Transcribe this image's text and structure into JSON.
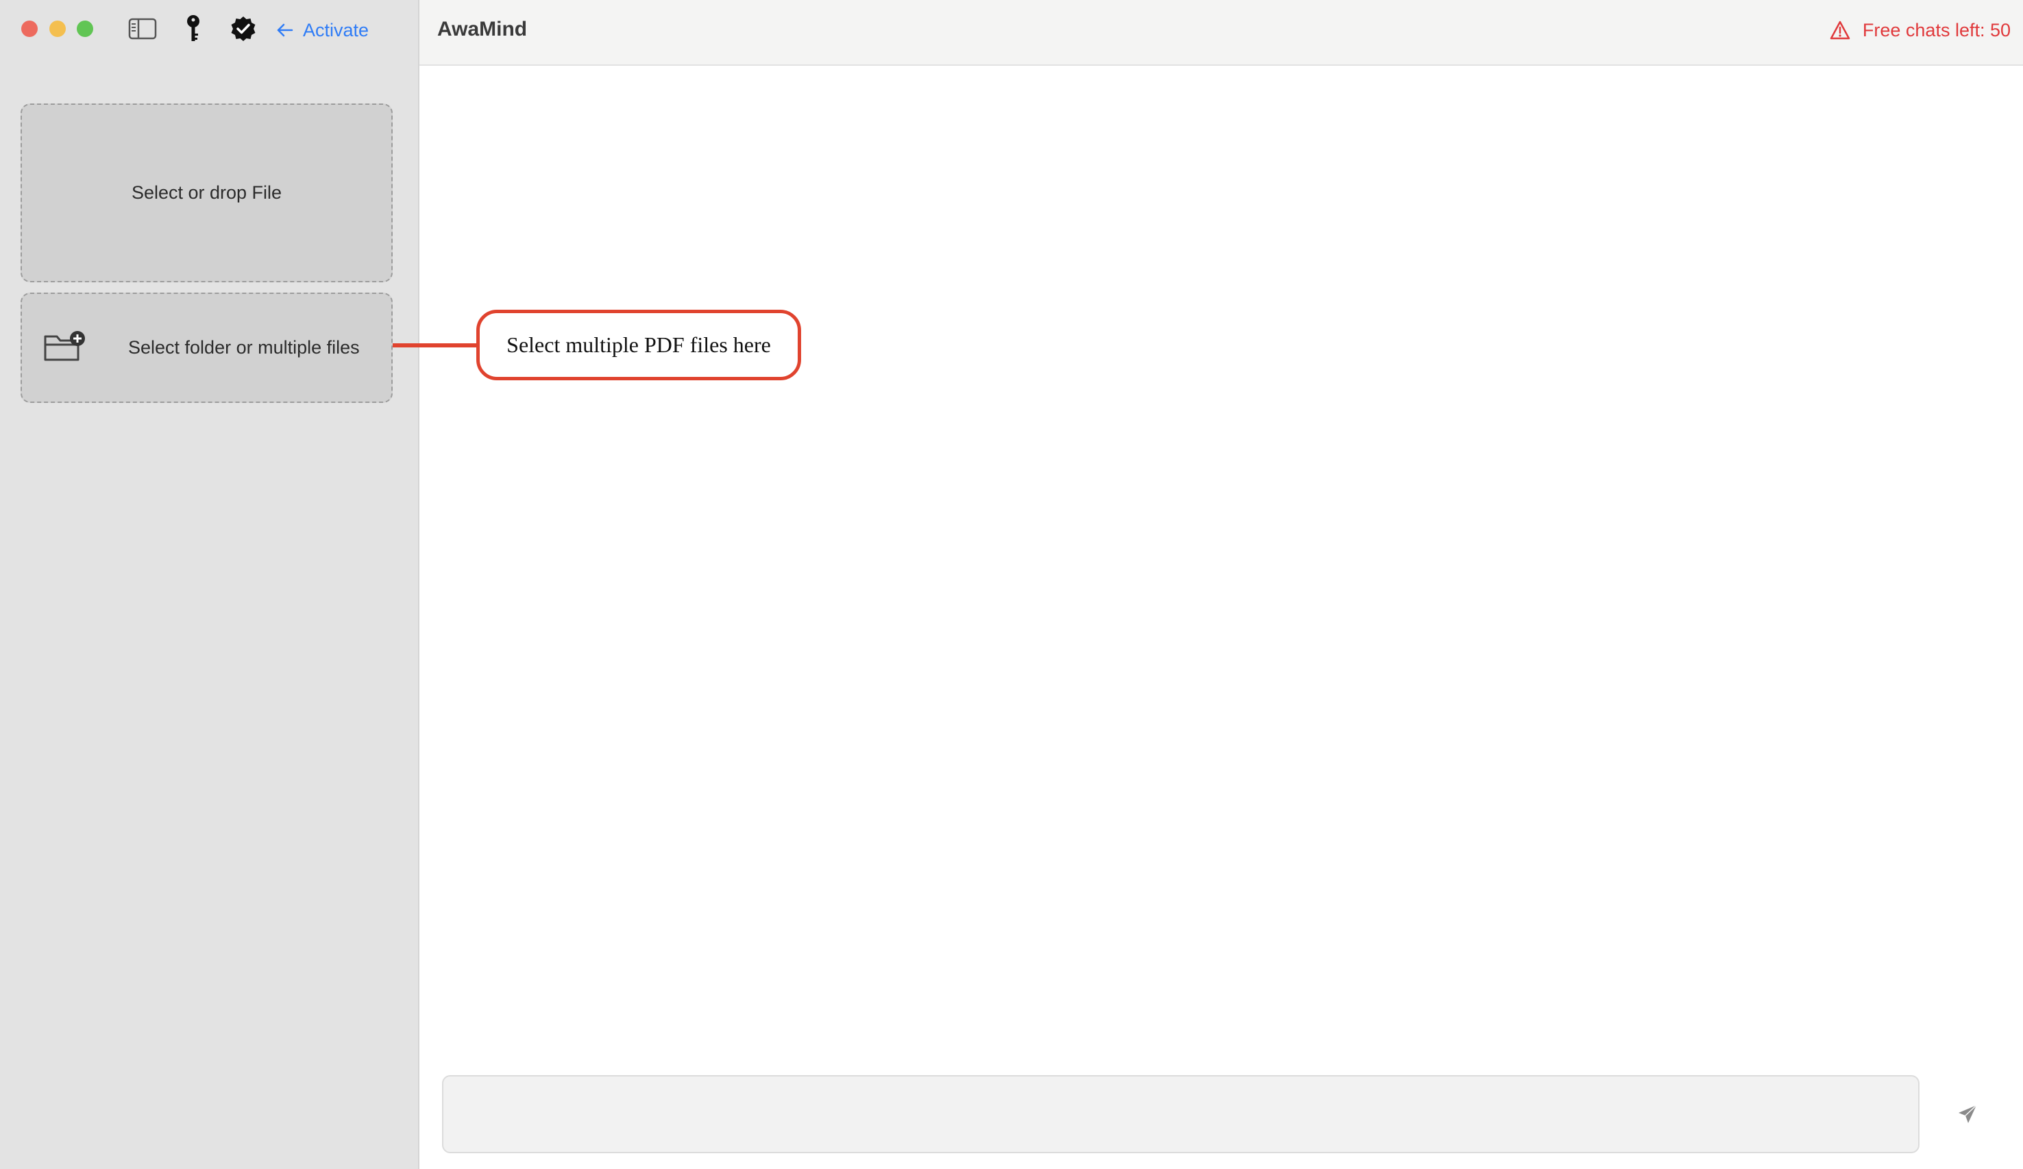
{
  "window": {
    "controls": [
      "close",
      "minimize",
      "maximize"
    ]
  },
  "toolbar": {
    "icons": [
      "sidebar-toggle-icon",
      "key-icon",
      "verified-badge-icon"
    ],
    "activate_label": "Activate"
  },
  "sidebar": {
    "file_drop_label": "Select or drop File",
    "folder_select_label": "Select folder or multiple files"
  },
  "header": {
    "app_title": "AwaMind",
    "free_chats_label": "Free chats left: 50"
  },
  "annotation": {
    "callout_text": "Select multiple PDF files here",
    "color": "#e0432e"
  },
  "chat": {
    "input_value": "",
    "input_placeholder": ""
  },
  "colors": {
    "accent": "#2f7cf6",
    "warning": "#e0393b",
    "sidebar_bg": "#e3e3e3"
  }
}
